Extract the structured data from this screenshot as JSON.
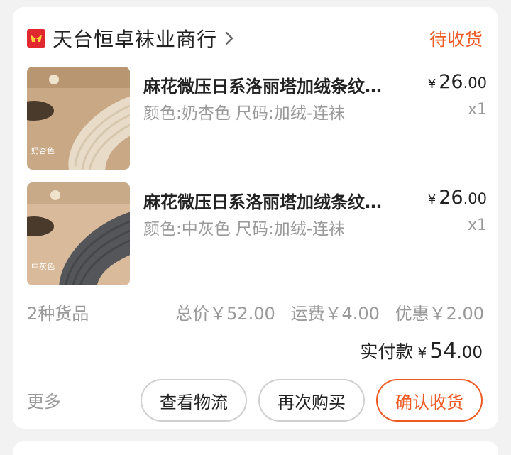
{
  "shop": {
    "name": "天台恒卓袜业商行",
    "status": "待收货"
  },
  "items": [
    {
      "title": "麻花微压日系洛丽塔加绒条纹…",
      "sku": "颜色:奶杏色 尺码:加绒-连袜",
      "price_symbol": "¥",
      "price_int": "26",
      "price_dec": ".00",
      "qty": "x1",
      "thumb_label": "奶杏色",
      "thumb_color": "#e8dcc9"
    },
    {
      "title": "麻花微压日系洛丽塔加绒条纹…",
      "sku": "颜色:中灰色 尺码:加绒-连袜",
      "price_symbol": "¥",
      "price_int": "26",
      "price_dec": ".00",
      "qty": "x1",
      "thumb_label": "中灰色",
      "thumb_color": "#55565a"
    }
  ],
  "summary": {
    "goods_count": "2种货品",
    "total": "总价￥52.00",
    "shipping": "运费￥4.00",
    "discount": "优惠￥2.00"
  },
  "paid": {
    "label": "实付款",
    "symbol": "¥",
    "int": "54",
    "dec": ".00"
  },
  "actions": {
    "more": "更多",
    "view_logistics": "查看物流",
    "buy_again": "再次购买",
    "confirm_receipt": "确认收货"
  },
  "colors": {
    "accent": "#ee5a24",
    "shop_logo": "#e0282e"
  }
}
